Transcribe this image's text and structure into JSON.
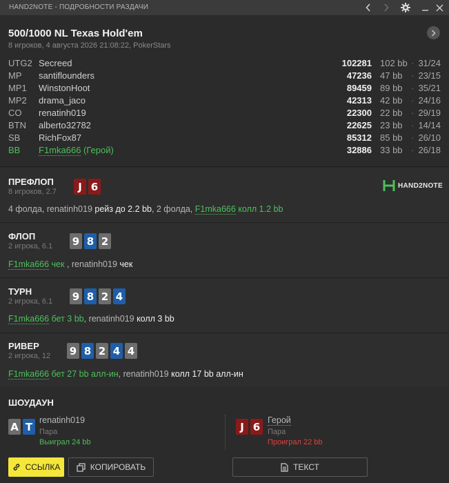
{
  "window": {
    "title": "HAND2NOTE - ПОДРОБНОСТИ РАЗДАЧИ",
    "controls": [
      "chevron-left-icon",
      "chevron-right-icon",
      "gear-icon",
      "minimize-icon",
      "close-icon"
    ]
  },
  "header": {
    "game_title": "500/1000 NL Texas Hold'em",
    "subtitle": "8 игроков, 4 августа 2026 21:08:22, PokerStars"
  },
  "players": [
    {
      "pos": "UTG2",
      "name": "Secreed",
      "stack": "102281",
      "bb": "102 bb",
      "dot": "·",
      "stat": "31/24",
      "hero": false
    },
    {
      "pos": "MP",
      "name": "santiflounders",
      "stack": "47236",
      "bb": "47 bb",
      "dot": "·",
      "stat": "23/15",
      "hero": false
    },
    {
      "pos": "MP1",
      "name": "WinstonHoot",
      "stack": "89459",
      "bb": "89 bb",
      "dot": "·",
      "stat": "35/21",
      "hero": false
    },
    {
      "pos": "MP2",
      "name": "drama_jaco",
      "stack": "42313",
      "bb": "42 bb",
      "dot": "·",
      "stat": "24/16",
      "hero": false
    },
    {
      "pos": "CO",
      "name": "renatinh019",
      "stack": "22300",
      "bb": "22 bb",
      "dot": "·",
      "stat": "29/19",
      "hero": false
    },
    {
      "pos": "BTN",
      "name": "alberto32782",
      "stack": "22625",
      "bb": "23 bb",
      "dot": "·",
      "stat": "14/14",
      "hero": false
    },
    {
      "pos": "SB",
      "name": "RichFox87",
      "stack": "85312",
      "bb": "85 bb",
      "dot": "·",
      "stat": "26/10",
      "hero": false
    },
    {
      "pos": "BB",
      "name": "F1mka666",
      "hero_tag": "(Герой)",
      "stack": "32886",
      "bb": "33 bb",
      "dot": "·",
      "stat": "26/18",
      "hero": true
    }
  ],
  "logo": {
    "text": "HAND2NOTE"
  },
  "colors": {
    "accent_green": "#4cc05b",
    "card_red": "#8a1a1a",
    "card_blue": "#1f5ea8",
    "card_grey": "#6d6d6d",
    "button_yellow": "#f5e63a",
    "loss_red": "#e2403a"
  },
  "streets": {
    "preflop": {
      "name": "ПРЕФЛОП",
      "sub": "8 игроков, 2.7",
      "cards": [
        {
          "rank": "J",
          "color": "red"
        },
        {
          "rank": "6",
          "color": "red"
        }
      ],
      "action": {
        "p1": "4 фолда, renatinh019 ",
        "p2": "рейз до 2.2 bb",
        "p3": ", 2 фолда, ",
        "hero": "F1mka666",
        "p4": " колл 1.2 bb"
      }
    },
    "flop": {
      "name": "ФЛОП",
      "sub": "2 игрока, 6.1",
      "cards": [
        {
          "rank": "9",
          "color": "grey"
        },
        {
          "rank": "8",
          "color": "blue"
        },
        {
          "rank": "2",
          "color": "grey"
        }
      ],
      "action": {
        "hero": "F1mka666",
        "p1": " чек",
        "p2": " , renatinh019 ",
        "p3": "чек"
      }
    },
    "turn": {
      "name": "ТУРН",
      "sub": "2 игрока, 6.1",
      "cards": [
        {
          "rank": "9",
          "color": "grey"
        },
        {
          "rank": "8",
          "color": "blue"
        },
        {
          "rank": "2",
          "color": "grey"
        },
        {
          "rank": "4",
          "color": "blue"
        }
      ],
      "action": {
        "hero": "F1mka666",
        "p1": " бет 3 bb",
        "p2": ", renatinh019 ",
        "p3": "колл 3 bb"
      }
    },
    "river": {
      "name": "РИВЕР",
      "sub": "2 игрока, 12",
      "cards": [
        {
          "rank": "9",
          "color": "grey"
        },
        {
          "rank": "8",
          "color": "blue"
        },
        {
          "rank": "2",
          "color": "grey"
        },
        {
          "rank": "4",
          "color": "blue"
        },
        {
          "rank": "4",
          "color": "grey"
        }
      ],
      "action": {
        "hero": "F1mka666",
        "p1": " бет 27 bb алл-ин",
        "p2": ", renatinh019 ",
        "p3": "колл 17 bb алл-ин"
      }
    }
  },
  "showdown": {
    "title": "ШОУДАУН",
    "left": {
      "cards": [
        {
          "rank": "A",
          "color": "grey"
        },
        {
          "rank": "T",
          "color": "blue"
        }
      ],
      "name": "renatinh019",
      "hand": "Пара",
      "result": "Выиграл 24 bb"
    },
    "right": {
      "cards": [
        {
          "rank": "J",
          "color": "red"
        },
        {
          "rank": "6",
          "color": "red"
        }
      ],
      "name": "Герой",
      "hand": "Пара",
      "result": "Проиграл 22 bb"
    }
  },
  "buttons": {
    "link": "ССЫЛКА",
    "copy": "КОПИРОВАТЬ",
    "text": "ТЕКСТ"
  }
}
